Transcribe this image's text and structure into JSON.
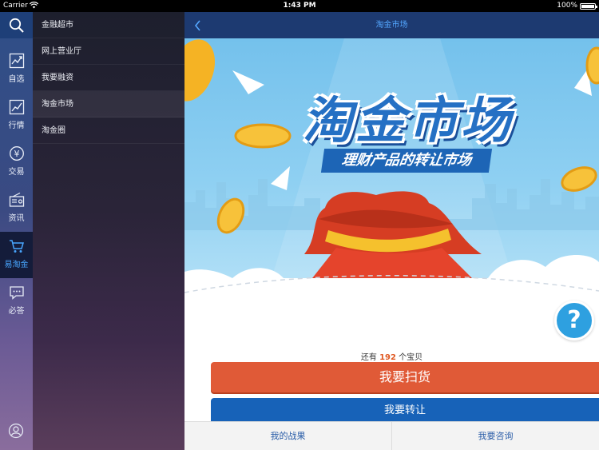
{
  "status_bar": {
    "carrier": "Carrier",
    "time": "1:43 PM",
    "battery": "100%"
  },
  "rail": {
    "items": [
      {
        "label": "自选",
        "icon": "stock-chart-icon"
      },
      {
        "label": "行情",
        "icon": "market-chart-icon"
      },
      {
        "label": "交易",
        "icon": "yen-coin-icon"
      },
      {
        "label": "资讯",
        "icon": "radio-news-icon"
      },
      {
        "label": "易淘金",
        "icon": "cart-icon",
        "active": true
      },
      {
        "label": "必答",
        "icon": "chat-bubble-icon"
      }
    ]
  },
  "submenu": {
    "items": [
      {
        "label": "金融超市"
      },
      {
        "label": "网上营业厅"
      },
      {
        "label": "我要融资"
      },
      {
        "label": "淘金市场",
        "active": true
      },
      {
        "label": "淘金圈"
      }
    ]
  },
  "navbar": {
    "title": "淘金市场"
  },
  "banner": {
    "title": "淘金市场",
    "subtitle": "理财产品的转让市场"
  },
  "main": {
    "remaining_prefix": "还有",
    "remaining_count": "192",
    "remaining_suffix": "个宝贝",
    "sweep_button": "我要扫货",
    "transfer_button": "我要转让",
    "help_symbol": "?"
  },
  "bottom_tabs": [
    {
      "label": "我的战果"
    },
    {
      "label": "我要咨询"
    }
  ],
  "colors": {
    "accent_blue": "#48a6ff",
    "sweep_orange": "#e05a37",
    "transfer_blue": "#1762b8",
    "nav_dark_blue": "#1d3a71"
  }
}
